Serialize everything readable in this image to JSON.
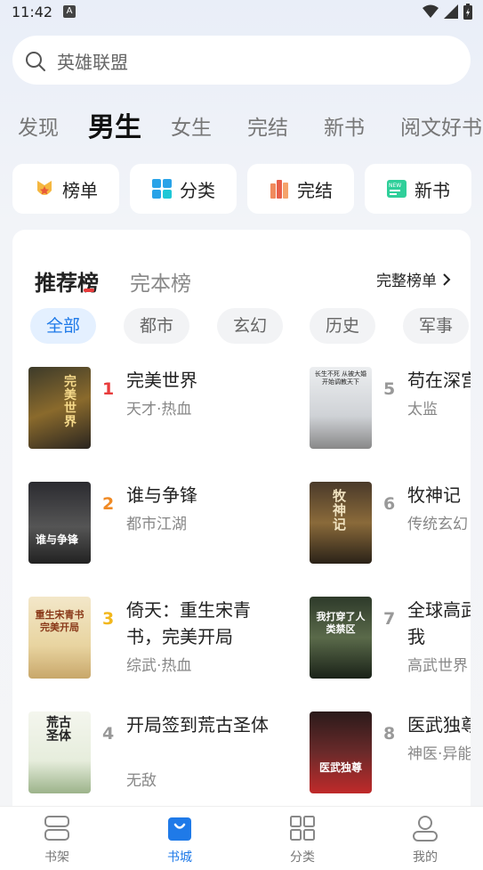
{
  "status": {
    "time": "11:42",
    "notif_letter": "A"
  },
  "search": {
    "placeholder": "英雄联盟"
  },
  "tabs": [
    "发现",
    "男生",
    "女生",
    "完结",
    "新书",
    "阅文好书"
  ],
  "quick_links": [
    {
      "label": "榜单",
      "icon": "medal-icon"
    },
    {
      "label": "分类",
      "icon": "grid-icon"
    },
    {
      "label": "完结",
      "icon": "books-icon"
    },
    {
      "label": "新书",
      "icon": "new-badge-icon"
    }
  ],
  "ranking": {
    "title": "推荐榜",
    "alt_title": "完本榜",
    "full_list": "完整榜单"
  },
  "genres": [
    "全部",
    "都市",
    "玄幻",
    "历史",
    "军事"
  ],
  "books": [
    {
      "rank": "1",
      "title": "完美世界",
      "tags": "天才·热血"
    },
    {
      "rank": "2",
      "title": "谁与争锋",
      "tags": "都市江湖"
    },
    {
      "rank": "3",
      "title": "倚天：重生宋青书，完美开局",
      "tags": "综武·热血"
    },
    {
      "rank": "4",
      "title": "开局签到荒古圣体",
      "tags": "无敌"
    },
    {
      "rank": "5",
      "title": "苟在深宫",
      "tags": "太监"
    },
    {
      "rank": "6",
      "title": "牧神记",
      "tags": "传统玄幻"
    },
    {
      "rank": "7",
      "title": "全球高武：成神，我",
      "tags": "高武世界"
    },
    {
      "rank": "8",
      "title": "医武独尊",
      "tags": "神医·异能"
    }
  ],
  "covers": [
    {
      "text": "完美世界"
    },
    {
      "text": "谁与争锋"
    },
    {
      "text": "重生宋青书完美开局"
    },
    {
      "text": "荒古圣体"
    },
    {
      "text": "长生不死 从被大婚开始调教天下"
    },
    {
      "text": "牧神记"
    },
    {
      "text": "我打穿了人类禁区"
    },
    {
      "text": "医武独尊"
    }
  ],
  "bottom_nav": [
    {
      "label": "书架"
    },
    {
      "label": "书城"
    },
    {
      "label": "分类"
    },
    {
      "label": "我的"
    }
  ],
  "colors": {
    "accent": "#1f7ae8",
    "rank1": "#e83c3c",
    "rank2": "#f08a24",
    "rank3": "#f2b71c",
    "rank_other": "#999999"
  }
}
